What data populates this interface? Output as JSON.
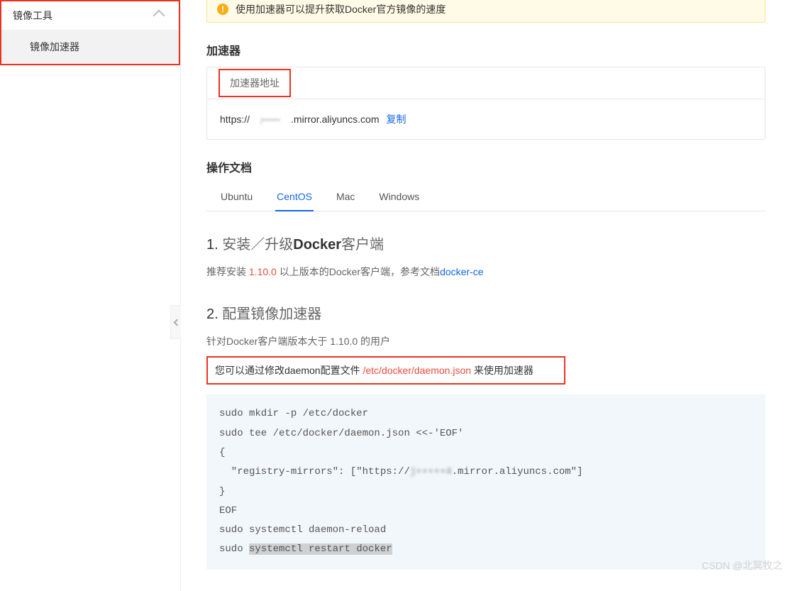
{
  "sidebar": {
    "group_title": "镜像工具",
    "items": [
      "镜像加速器"
    ]
  },
  "notice": {
    "text": "使用加速器可以提升获取Docker官方镜像的速度"
  },
  "accelerator": {
    "title": "加速器",
    "card_header": "加速器地址",
    "addr_prefix": "https://",
    "addr_masked": "j••••••",
    "addr_suffix": ".mirror.aliyuncs.com",
    "copy_label": "复制"
  },
  "docs": {
    "title": "操作文档",
    "tabs": [
      "Ubuntu",
      "CentOS",
      "Mac",
      "Windows"
    ],
    "active_tab_index": 1,
    "step1": {
      "num": "1.",
      "pre": " 安装／升级",
      "strong": "Docker",
      "post": "客户端"
    },
    "step1_para": {
      "p1": "推荐安装 ",
      "ver": "1.10.0",
      "p2": " 以上版本的Docker客户端，参考文档",
      "link": "docker-ce"
    },
    "step2": {
      "num": "2.",
      "text": " 配置镜像加速器"
    },
    "step2_para1": "针对Docker客户端版本大于 1.10.0 的用户",
    "step2_box": {
      "p1": "您可以通过修改daemon配置文件 ",
      "path": "/etc/docker/daemon.json",
      "p2": " 来使用加速器"
    },
    "code": {
      "l1": "sudo mkdir -p /etc/docker",
      "l2": "sudo tee /etc/docker/daemon.json <<-'EOF'",
      "l3": "{",
      "l4a": "  \"registry-mirrors\": [\"https://",
      "l4mask": "j•••••4",
      "l4b": ".mirror.aliyuncs.com\"]",
      "l5": "}",
      "l6": "EOF",
      "l7": "sudo systemctl daemon-reload",
      "l8a": "sudo ",
      "l8hl": "systemctl restart docker"
    }
  },
  "watermark": "CSDN @北冥牧之"
}
